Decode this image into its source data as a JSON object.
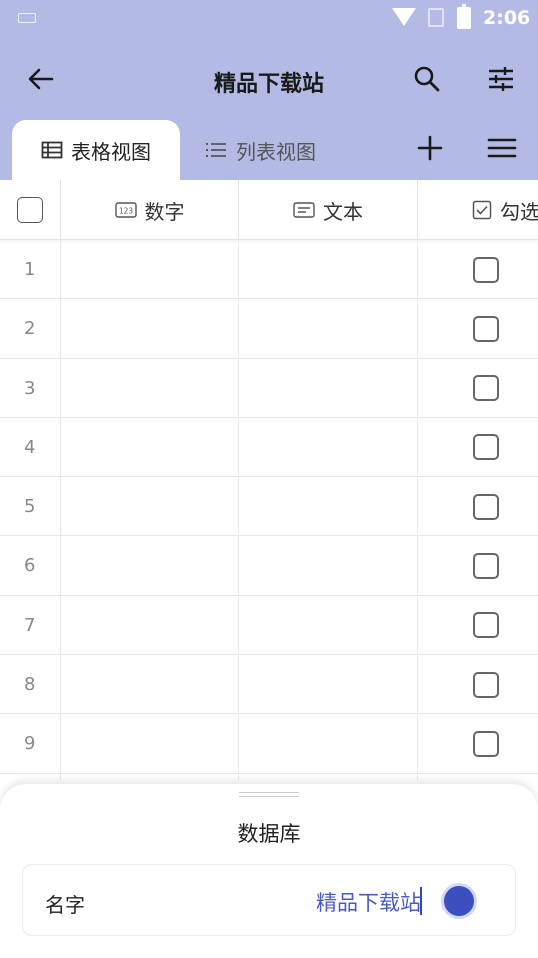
{
  "status_bar": {
    "time": "2:06"
  },
  "app_bar": {
    "title": "精品下载站"
  },
  "tabs": [
    {
      "label": "表格视图",
      "active": true
    },
    {
      "label": "列表视图",
      "active": false
    }
  ],
  "table": {
    "columns": [
      {
        "label": "数字",
        "icon": "number-field-icon"
      },
      {
        "label": "文本",
        "icon": "text-field-icon"
      },
      {
        "label": "勾选",
        "icon": "checkbox-field-icon"
      }
    ],
    "rows": [
      "1",
      "2",
      "3",
      "4",
      "5",
      "6",
      "7",
      "8",
      "9"
    ]
  },
  "sheet": {
    "title": "数据库",
    "field_label": "名字",
    "field_value": "精品下载站",
    "color_dot": "#3c4fc0"
  },
  "colors": {
    "header_bg": "#b3bbe4",
    "accent": "#4a5bc2"
  }
}
